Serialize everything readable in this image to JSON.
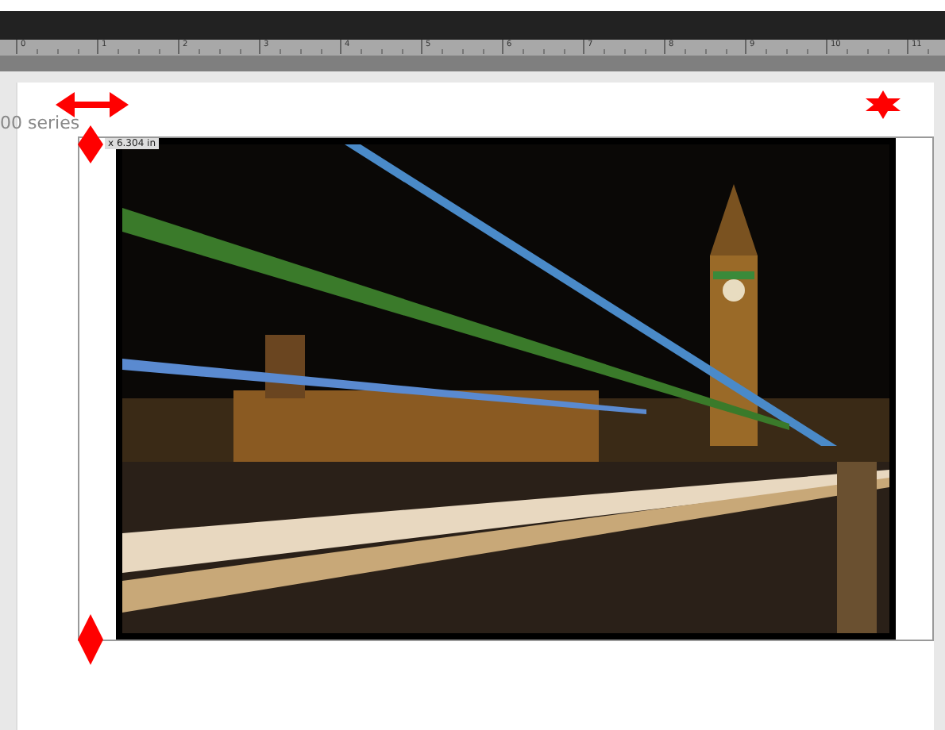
{
  "ruler": {
    "labels": [
      "0",
      "1",
      "2",
      "3",
      "4",
      "5",
      "6",
      "7",
      "8",
      "9",
      "10",
      "11"
    ]
  },
  "page": {
    "series_label": "00 series",
    "size_label": "x 6.304 in"
  }
}
